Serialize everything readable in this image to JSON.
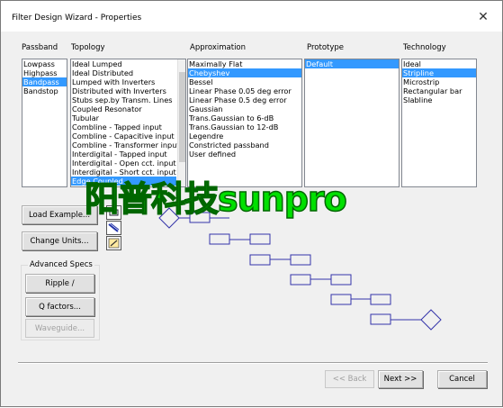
{
  "window": {
    "title": "Filter Design Wizard - Properties",
    "close_glyph": "✕"
  },
  "columns": {
    "passband": {
      "label": "Passband",
      "items": [
        "Lowpass",
        "Highpass",
        "Bandpass",
        "Bandstop"
      ],
      "selected": 2
    },
    "topology": {
      "label": "Topology",
      "items": [
        "Ideal Lumped",
        "Ideal Distributed",
        "Lumped with Inverters",
        "Distributed with Inverters",
        "Stubs sep.by Transm. Lines",
        "Coupled Resonator",
        "Tubular",
        "Combline - Tapped input",
        "Combline - Capacitive input",
        "Combline - Transformer input",
        "Interdigital - Tapped input",
        "Interdigital - Open cct. input",
        "Interdigital - Short cct. input",
        "Edge Coupled"
      ],
      "selected": 13
    },
    "approximation": {
      "label": "Approximation",
      "items": [
        "Maximally Flat",
        "Chebyshev",
        "Bessel",
        "Linear Phase 0.05 deg error",
        "Linear Phase 0.5 deg error",
        "Gaussian",
        "Trans.Gaussian to 6-dB",
        "Trans.Gaussian to 12-dB",
        "Legendre",
        "Constricted passband",
        "User defined"
      ],
      "selected": 1
    },
    "prototype": {
      "label": "Prototype",
      "items": [
        "Default"
      ],
      "selected": 0
    },
    "technology": {
      "label": "Technology",
      "items": [
        "Ideal",
        "Stripline",
        "Microstrip",
        "Rectangular bar",
        "Slabline"
      ],
      "selected": 1
    }
  },
  "buttons": {
    "load_example": "Load Example...",
    "change_units": "Change Units...",
    "ripple": "Ripple / Corners...",
    "q_factors": "Q factors...",
    "waveguide": "Waveguide...",
    "back": "<< Back",
    "next": "Next >>",
    "cancel": "Cancel"
  },
  "advanced_specs_label": "Advanced Specs",
  "watermark": "阳普科技sunpro",
  "colors": {
    "selection": "#3399ff",
    "watermark": "#00e000",
    "diagram": "#3333aa"
  }
}
